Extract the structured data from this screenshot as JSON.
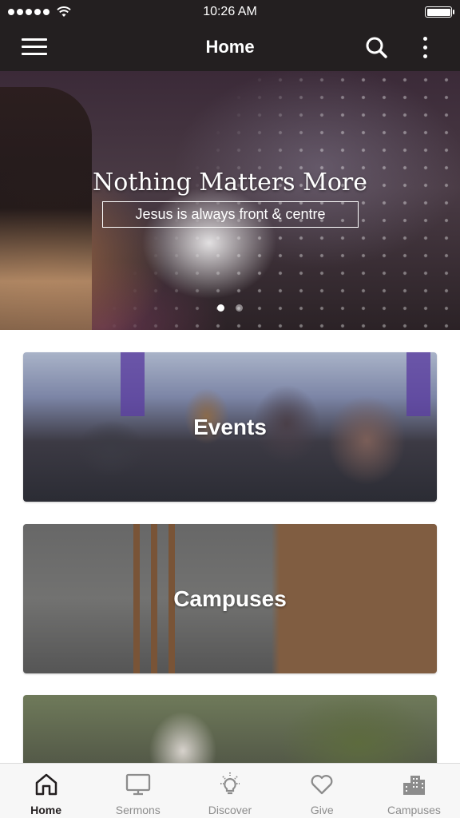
{
  "status_bar": {
    "time": "10:26 AM"
  },
  "header": {
    "title": "Home"
  },
  "hero": {
    "title": "Nothing Matters More",
    "subtitle": "Jesus is always front & centre",
    "slide_count": 2,
    "active_slide": 1
  },
  "cards": {
    "events": "Events",
    "campuses": "Campuses"
  },
  "tabs": [
    {
      "label": "Home",
      "icon": "home-icon",
      "active": true
    },
    {
      "label": "Sermons",
      "icon": "monitor-icon",
      "active": false
    },
    {
      "label": "Discover",
      "icon": "lightbulb-icon",
      "active": false
    },
    {
      "label": "Give",
      "icon": "heart-icon",
      "active": false
    },
    {
      "label": "Campuses",
      "icon": "buildings-icon",
      "active": false
    }
  ],
  "colors": {
    "bar_background": "#231f20",
    "tab_active": "#231f20",
    "tab_inactive": "#8c8c8c"
  }
}
